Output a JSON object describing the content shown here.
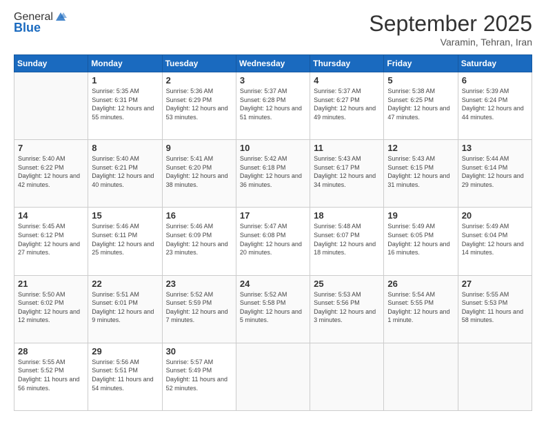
{
  "logo": {
    "general": "General",
    "blue": "Blue"
  },
  "header": {
    "month": "September 2025",
    "location": "Varamin, Tehran, Iran"
  },
  "weekdays": [
    "Sunday",
    "Monday",
    "Tuesday",
    "Wednesday",
    "Thursday",
    "Friday",
    "Saturday"
  ],
  "weeks": [
    [
      {
        "day": "",
        "info": ""
      },
      {
        "day": "1",
        "sunrise": "Sunrise: 5:35 AM",
        "sunset": "Sunset: 6:31 PM",
        "daylight": "Daylight: 12 hours and 55 minutes."
      },
      {
        "day": "2",
        "sunrise": "Sunrise: 5:36 AM",
        "sunset": "Sunset: 6:29 PM",
        "daylight": "Daylight: 12 hours and 53 minutes."
      },
      {
        "day": "3",
        "sunrise": "Sunrise: 5:37 AM",
        "sunset": "Sunset: 6:28 PM",
        "daylight": "Daylight: 12 hours and 51 minutes."
      },
      {
        "day": "4",
        "sunrise": "Sunrise: 5:37 AM",
        "sunset": "Sunset: 6:27 PM",
        "daylight": "Daylight: 12 hours and 49 minutes."
      },
      {
        "day": "5",
        "sunrise": "Sunrise: 5:38 AM",
        "sunset": "Sunset: 6:25 PM",
        "daylight": "Daylight: 12 hours and 47 minutes."
      },
      {
        "day": "6",
        "sunrise": "Sunrise: 5:39 AM",
        "sunset": "Sunset: 6:24 PM",
        "daylight": "Daylight: 12 hours and 44 minutes."
      }
    ],
    [
      {
        "day": "7",
        "sunrise": "Sunrise: 5:40 AM",
        "sunset": "Sunset: 6:22 PM",
        "daylight": "Daylight: 12 hours and 42 minutes."
      },
      {
        "day": "8",
        "sunrise": "Sunrise: 5:40 AM",
        "sunset": "Sunset: 6:21 PM",
        "daylight": "Daylight: 12 hours and 40 minutes."
      },
      {
        "day": "9",
        "sunrise": "Sunrise: 5:41 AM",
        "sunset": "Sunset: 6:20 PM",
        "daylight": "Daylight: 12 hours and 38 minutes."
      },
      {
        "day": "10",
        "sunrise": "Sunrise: 5:42 AM",
        "sunset": "Sunset: 6:18 PM",
        "daylight": "Daylight: 12 hours and 36 minutes."
      },
      {
        "day": "11",
        "sunrise": "Sunrise: 5:43 AM",
        "sunset": "Sunset: 6:17 PM",
        "daylight": "Daylight: 12 hours and 34 minutes."
      },
      {
        "day": "12",
        "sunrise": "Sunrise: 5:43 AM",
        "sunset": "Sunset: 6:15 PM",
        "daylight": "Daylight: 12 hours and 31 minutes."
      },
      {
        "day": "13",
        "sunrise": "Sunrise: 5:44 AM",
        "sunset": "Sunset: 6:14 PM",
        "daylight": "Daylight: 12 hours and 29 minutes."
      }
    ],
    [
      {
        "day": "14",
        "sunrise": "Sunrise: 5:45 AM",
        "sunset": "Sunset: 6:12 PM",
        "daylight": "Daylight: 12 hours and 27 minutes."
      },
      {
        "day": "15",
        "sunrise": "Sunrise: 5:46 AM",
        "sunset": "Sunset: 6:11 PM",
        "daylight": "Daylight: 12 hours and 25 minutes."
      },
      {
        "day": "16",
        "sunrise": "Sunrise: 5:46 AM",
        "sunset": "Sunset: 6:09 PM",
        "daylight": "Daylight: 12 hours and 23 minutes."
      },
      {
        "day": "17",
        "sunrise": "Sunrise: 5:47 AM",
        "sunset": "Sunset: 6:08 PM",
        "daylight": "Daylight: 12 hours and 20 minutes."
      },
      {
        "day": "18",
        "sunrise": "Sunrise: 5:48 AM",
        "sunset": "Sunset: 6:07 PM",
        "daylight": "Daylight: 12 hours and 18 minutes."
      },
      {
        "day": "19",
        "sunrise": "Sunrise: 5:49 AM",
        "sunset": "Sunset: 6:05 PM",
        "daylight": "Daylight: 12 hours and 16 minutes."
      },
      {
        "day": "20",
        "sunrise": "Sunrise: 5:49 AM",
        "sunset": "Sunset: 6:04 PM",
        "daylight": "Daylight: 12 hours and 14 minutes."
      }
    ],
    [
      {
        "day": "21",
        "sunrise": "Sunrise: 5:50 AM",
        "sunset": "Sunset: 6:02 PM",
        "daylight": "Daylight: 12 hours and 12 minutes."
      },
      {
        "day": "22",
        "sunrise": "Sunrise: 5:51 AM",
        "sunset": "Sunset: 6:01 PM",
        "daylight": "Daylight: 12 hours and 9 minutes."
      },
      {
        "day": "23",
        "sunrise": "Sunrise: 5:52 AM",
        "sunset": "Sunset: 5:59 PM",
        "daylight": "Daylight: 12 hours and 7 minutes."
      },
      {
        "day": "24",
        "sunrise": "Sunrise: 5:52 AM",
        "sunset": "Sunset: 5:58 PM",
        "daylight": "Daylight: 12 hours and 5 minutes."
      },
      {
        "day": "25",
        "sunrise": "Sunrise: 5:53 AM",
        "sunset": "Sunset: 5:56 PM",
        "daylight": "Daylight: 12 hours and 3 minutes."
      },
      {
        "day": "26",
        "sunrise": "Sunrise: 5:54 AM",
        "sunset": "Sunset: 5:55 PM",
        "daylight": "Daylight: 12 hours and 1 minute."
      },
      {
        "day": "27",
        "sunrise": "Sunrise: 5:55 AM",
        "sunset": "Sunset: 5:53 PM",
        "daylight": "Daylight: 11 hours and 58 minutes."
      }
    ],
    [
      {
        "day": "28",
        "sunrise": "Sunrise: 5:55 AM",
        "sunset": "Sunset: 5:52 PM",
        "daylight": "Daylight: 11 hours and 56 minutes."
      },
      {
        "day": "29",
        "sunrise": "Sunrise: 5:56 AM",
        "sunset": "Sunset: 5:51 PM",
        "daylight": "Daylight: 11 hours and 54 minutes."
      },
      {
        "day": "30",
        "sunrise": "Sunrise: 5:57 AM",
        "sunset": "Sunset: 5:49 PM",
        "daylight": "Daylight: 11 hours and 52 minutes."
      },
      {
        "day": "",
        "info": ""
      },
      {
        "day": "",
        "info": ""
      },
      {
        "day": "",
        "info": ""
      },
      {
        "day": "",
        "info": ""
      }
    ]
  ]
}
